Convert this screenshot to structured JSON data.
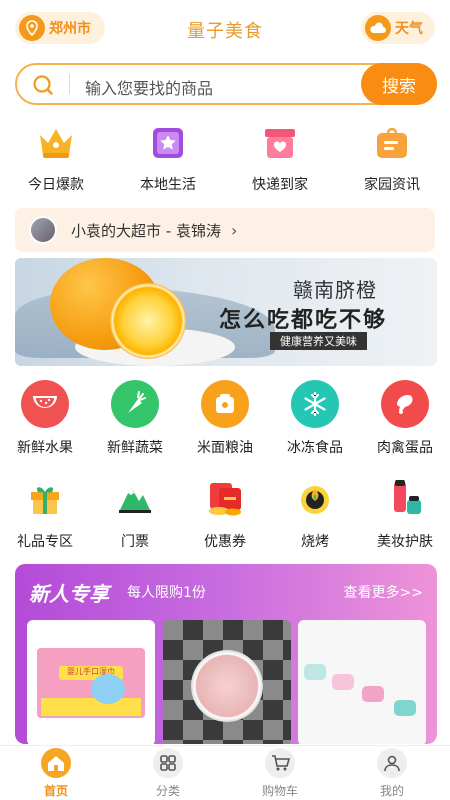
{
  "header": {
    "city": "郑州市",
    "title": "量子美食",
    "weather": "天气"
  },
  "search": {
    "placeholder": "输入您要找的商品",
    "button": "搜索"
  },
  "quick_entries": [
    {
      "label": "今日爆款",
      "icon": "crown-icon"
    },
    {
      "label": "本地生活",
      "icon": "star-book-icon"
    },
    {
      "label": "快递到家",
      "icon": "parcel-icon"
    },
    {
      "label": "家园资讯",
      "icon": "news-bag-icon"
    }
  ],
  "shop": {
    "name": "小袁的大超市 - 袁锦涛",
    "chevron": "›"
  },
  "banner": {
    "title": "赣南脐橙",
    "slogan": "怎么吃都吃不够",
    "tag": "健康营养又美味"
  },
  "categories_row1": [
    {
      "label": "新鲜水果",
      "icon": "watermelon-icon",
      "color": "#f05252"
    },
    {
      "label": "新鲜蔬菜",
      "icon": "carrot-icon",
      "color": "#34c46a"
    },
    {
      "label": "米面粮油",
      "icon": "rice-bowl-icon",
      "color": "#f8a11d"
    },
    {
      "label": "冰冻食品",
      "icon": "snowflake-icon",
      "color": "#25c7b4"
    },
    {
      "label": "肉禽蛋品",
      "icon": "chicken-leg-icon",
      "color": "#f24b4b"
    }
  ],
  "categories_row2": [
    {
      "label": "礼品专区",
      "icon": "gift-icon"
    },
    {
      "label": "门票",
      "icon": "mountain-ticket-icon"
    },
    {
      "label": "优惠券",
      "icon": "coupon-icon"
    },
    {
      "label": "烧烤",
      "icon": "bbq-icon"
    },
    {
      "label": "美妆护肤",
      "icon": "cosmetics-icon"
    }
  ],
  "new_user": {
    "title": "新人专享",
    "subtitle": "每人限购1份",
    "more": "查看更多>>",
    "product_pack_text": "婴儿手口湿巾"
  },
  "tabbar": [
    {
      "label": "首页",
      "icon": "home-icon",
      "active": true
    },
    {
      "label": "分类",
      "icon": "grid-icon",
      "active": false
    },
    {
      "label": "购物车",
      "icon": "cart-icon",
      "active": false
    },
    {
      "label": "我的",
      "icon": "user-icon",
      "active": false
    }
  ],
  "colors": {
    "accent": "#f98c12",
    "title": "#e99a2a",
    "promo_start": "#b44bd8",
    "promo_end": "#ee93d8"
  }
}
